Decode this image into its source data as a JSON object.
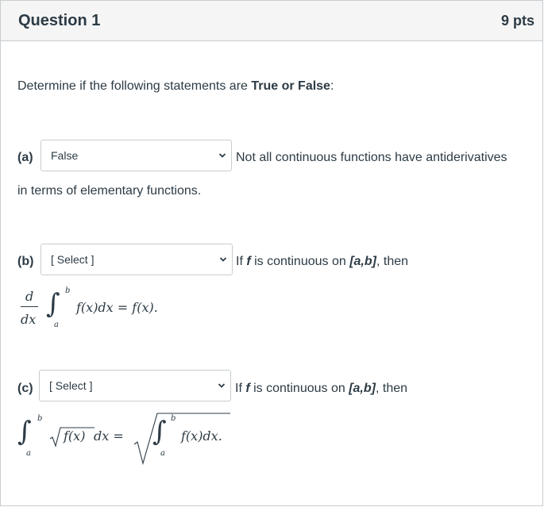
{
  "question": {
    "title": "Question 1",
    "points": "9 pts",
    "intro_prefix": "Determine if the following statements are ",
    "intro_bold": "True or False",
    "intro_suffix": ":"
  },
  "parts": {
    "a": {
      "label": "(a)",
      "selected": "False",
      "statement_line1": "Not all continuous functions have antiderivatives",
      "statement_line2": "in terms of elementary functions."
    },
    "b": {
      "label": "(b)",
      "selected": "[ Select ]",
      "if_text": "If ",
      "f": "f",
      "continuous_text": " is continuous on ",
      "interval": "[a,b]",
      "then_text": ",  then",
      "math": {
        "d": "d",
        "dx": "dx",
        "upper": "b",
        "lower": "a",
        "integrand": "f(x)dx = f(x)."
      }
    },
    "c": {
      "label": "(c)",
      "selected": "[ Select ]",
      "if_text": "If ",
      "f": "f",
      "continuous_text": " is continuous on ",
      "interval": "[a,b]",
      "then_text": ",  then",
      "math": {
        "upper": "b",
        "lower": "a",
        "sqrt_integrand": "f(x)",
        "dx_eq": "dx =",
        "upper2": "b",
        "lower2": "a",
        "integrand2": "f(x)dx."
      }
    }
  }
}
